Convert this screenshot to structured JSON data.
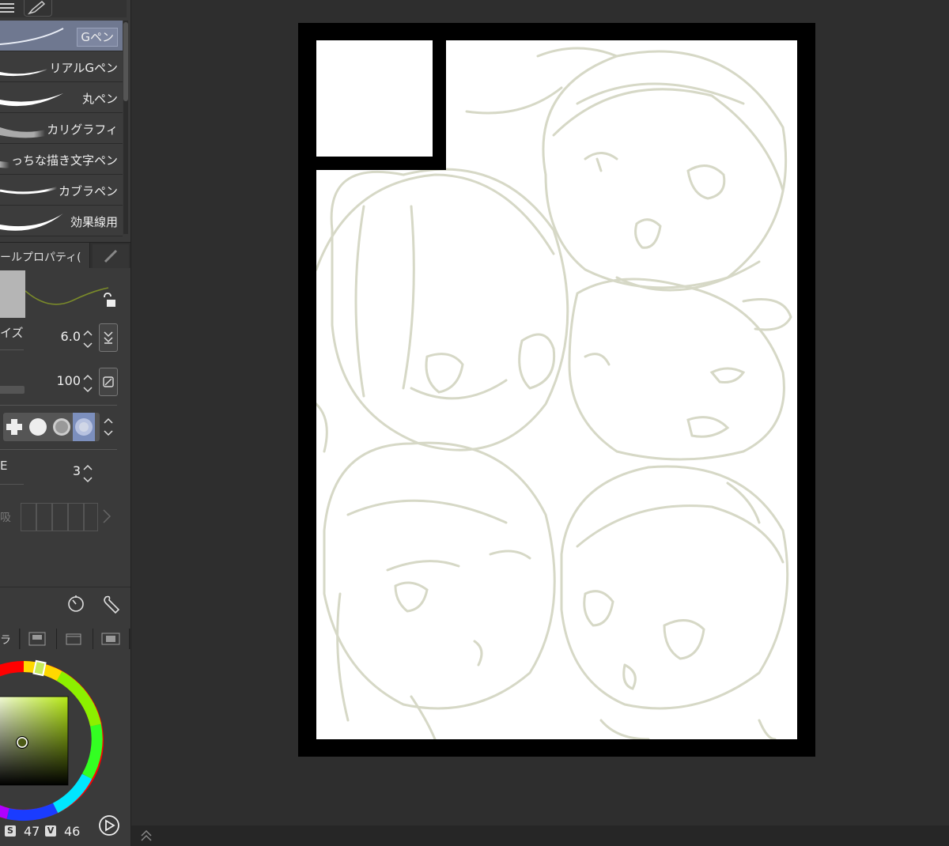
{
  "brushes": {
    "items": [
      {
        "label": "Gペン",
        "selected": true
      },
      {
        "label": "リアルGペン"
      },
      {
        "label": "丸ペン"
      },
      {
        "label": "カリグラフィ"
      },
      {
        "label": "っちな描き文字ペン"
      },
      {
        "label": "カブラペン"
      },
      {
        "label": "効果線用"
      }
    ]
  },
  "tool_property": {
    "tab_label": "ールプロパティ(",
    "size_label": "イズ",
    "size_value": "6.0",
    "opacity_value": "100",
    "stabilizer_label": "E",
    "stabilizer_value": "3",
    "absorb_label": "吸"
  },
  "color": {
    "tab_label": "ラ",
    "s_badge": "S",
    "s_value": "47",
    "v_badge": "V",
    "v_value": "46",
    "current_color": "#4c5a16"
  },
  "canvas": {
    "frame_color": "#000000",
    "sketch_color": "#d6d8c6"
  }
}
